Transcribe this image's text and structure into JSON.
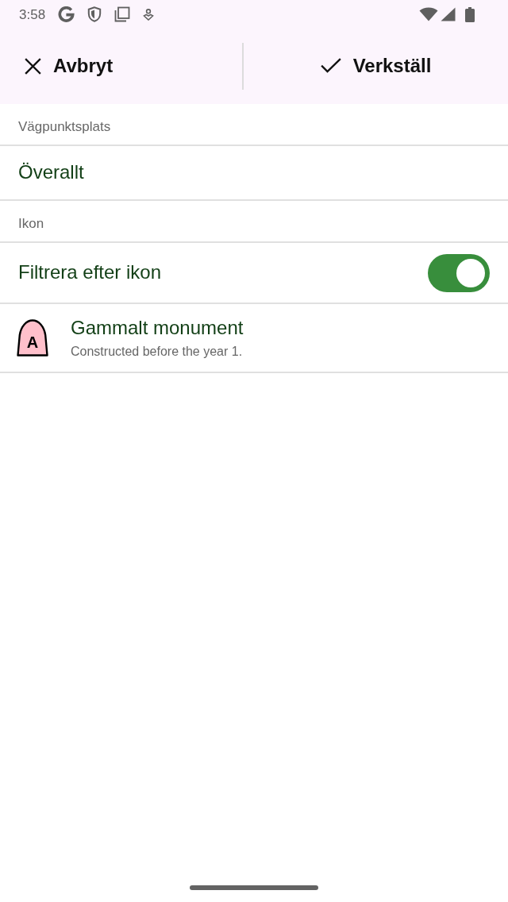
{
  "status_bar": {
    "time": "3:58"
  },
  "toolbar": {
    "actions": [
      {
        "kind": "cancel",
        "label": "Avbryt"
      },
      {
        "kind": "apply",
        "label": "Verkställ"
      }
    ]
  },
  "sections": [
    {
      "header": "Vägpunktsplats",
      "items": [
        {
          "kind": "text",
          "title": "Överallt"
        }
      ]
    },
    {
      "header": "Ikon",
      "items": [
        {
          "kind": "switch",
          "title": "Filtrera efter ikon",
          "on": true
        },
        {
          "kind": "icon",
          "icon_letter": "A",
          "title": "Gammalt monument",
          "subtitle": "Constructed before the year 1."
        }
      ]
    }
  ]
}
